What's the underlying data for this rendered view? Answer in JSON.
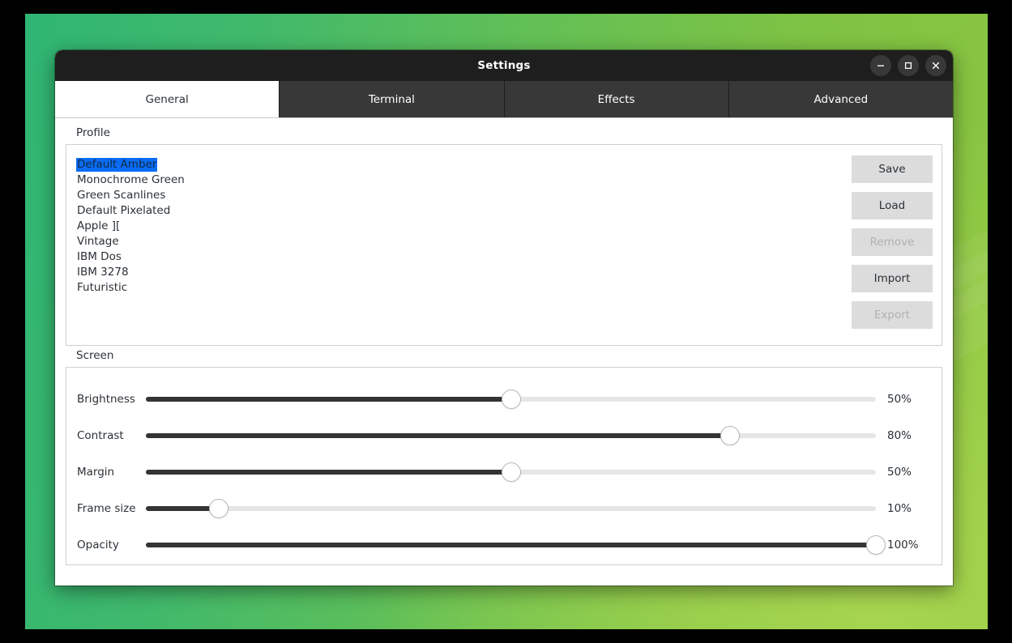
{
  "window": {
    "title": "Settings",
    "controls": [
      {
        "name": "minimize-button",
        "icon": "minimize-icon"
      },
      {
        "name": "maximize-button",
        "icon": "maximize-icon"
      },
      {
        "name": "close-button",
        "icon": "close-icon"
      }
    ]
  },
  "tabs": [
    {
      "label": "General",
      "active": true
    },
    {
      "label": "Terminal",
      "active": false
    },
    {
      "label": "Effects",
      "active": false
    },
    {
      "label": "Advanced",
      "active": false
    }
  ],
  "profile": {
    "group_title": "Profile",
    "items": [
      {
        "label": "Default Amber",
        "selected": true
      },
      {
        "label": "Monochrome Green",
        "selected": false
      },
      {
        "label": "Green Scanlines",
        "selected": false
      },
      {
        "label": "Default Pixelated",
        "selected": false
      },
      {
        "label": "Apple ][",
        "selected": false
      },
      {
        "label": "Vintage",
        "selected": false
      },
      {
        "label": "IBM Dos",
        "selected": false
      },
      {
        "label": "IBM 3278",
        "selected": false
      },
      {
        "label": "Futuristic",
        "selected": false
      }
    ],
    "buttons": [
      {
        "label": "Save",
        "enabled": true
      },
      {
        "label": "Load",
        "enabled": true
      },
      {
        "label": "Remove",
        "enabled": false
      },
      {
        "label": "Import",
        "enabled": true
      },
      {
        "label": "Export",
        "enabled": false
      }
    ]
  },
  "screen": {
    "group_title": "Screen",
    "sliders": [
      {
        "label": "Brightness",
        "value": 50,
        "display": "50%"
      },
      {
        "label": "Contrast",
        "value": 80,
        "display": "80%"
      },
      {
        "label": "Margin",
        "value": 50,
        "display": "50%"
      },
      {
        "label": "Frame size",
        "value": 10,
        "display": "10%"
      },
      {
        "label": "Opacity",
        "value": 100,
        "display": "100%"
      }
    ]
  },
  "colors": {
    "titlebar": "#1e1e1e",
    "tab_inactive": "#383838",
    "selection_blue": "#0a6cf5",
    "button_face": "#dcdcdc",
    "slider_fill": "#343434",
    "slider_track": "#e6e6e6",
    "desktop_green_left": "#2fb673",
    "desktop_green_right": "#8cc63f"
  }
}
